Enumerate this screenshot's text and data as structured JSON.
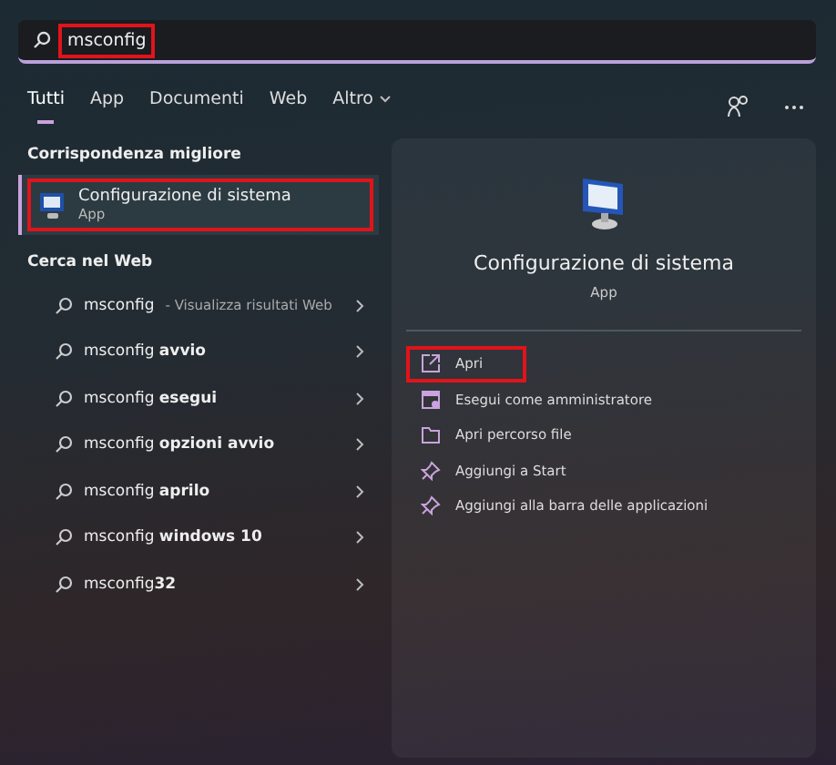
{
  "search": {
    "value": "msconfig",
    "highlighted": true
  },
  "tabs": [
    {
      "label": "Tutti",
      "selected": true
    },
    {
      "label": "App",
      "selected": false
    },
    {
      "label": "Documenti",
      "selected": false
    },
    {
      "label": "Web",
      "selected": false
    },
    {
      "label": "Altro",
      "selected": false,
      "dropdown": true
    }
  ],
  "best_match": {
    "heading": "Corrispondenza migliore",
    "title": "Configurazione di sistema",
    "subtitle": "App",
    "highlighted": true
  },
  "web": {
    "heading": "Cerca nel Web",
    "items": [
      {
        "text": "msconfig",
        "hint": "- Visualizza risultati Web"
      },
      {
        "text": "msconfig **avvio**"
      },
      {
        "text": "msconfig **esegui**"
      },
      {
        "text": "msconfig **opzioni avvio**"
      },
      {
        "text": "msconfig **aprilo**"
      },
      {
        "text": "msconfig **windows 10**"
      },
      {
        "text": "msconfig**32**"
      }
    ]
  },
  "detail": {
    "title": "Configurazione di sistema",
    "subtitle": "App",
    "actions": [
      {
        "kind": "open",
        "label": "Apri",
        "highlighted": true
      },
      {
        "kind": "admin",
        "label": "Esegui come amministratore",
        "highlighted": false
      },
      {
        "kind": "folder",
        "label": "Apri percorso file",
        "highlighted": false
      },
      {
        "kind": "pin",
        "label": "Aggiungi a Start",
        "highlighted": false
      },
      {
        "kind": "pin",
        "label": "Aggiungi alla barra delle applicazioni",
        "highlighted": false
      }
    ]
  }
}
